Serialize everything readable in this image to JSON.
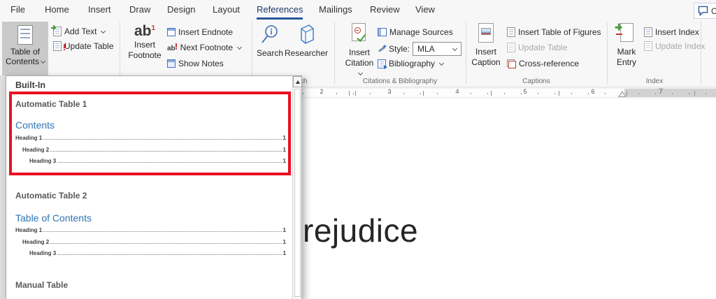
{
  "tabs": {
    "items": [
      "File",
      "Home",
      "Insert",
      "Draw",
      "Design",
      "Layout",
      "References",
      "Mailings",
      "Review",
      "View"
    ],
    "selected": "References"
  },
  "comments_button": {
    "visible_label": "C"
  },
  "ribbon": {
    "toc_button": {
      "line1": "Table of",
      "line2": "Contents"
    },
    "add_text_label": "Add Text",
    "update_table_label": "Update Table",
    "footnotes": {
      "insert_line1": "Insert",
      "insert_line2": "Footnote",
      "insert_endnote": "Insert Endnote",
      "next_footnote": "Next Footnote",
      "show_notes": "Show Notes"
    },
    "research": {
      "search": "Search",
      "researcher": "Researcher",
      "group_label": "Research"
    },
    "citations": {
      "insert_line1": "Insert",
      "insert_line2": "Citation",
      "manage_sources": "Manage Sources",
      "style_label": "Style:",
      "style_value": "MLA",
      "bibliography": "Bibliography",
      "group_label": "Citations & Bibliography"
    },
    "captions": {
      "insert_line1": "Insert",
      "insert_line2": "Caption",
      "insert_table_of_figures": "Insert Table of Figures",
      "update_table": "Update Table",
      "cross_reference": "Cross-reference",
      "group_label": "Captions"
    },
    "index": {
      "mark_line1": "Mark",
      "mark_line2": "Entry",
      "insert_index": "Insert Index",
      "update_index": "Update Index",
      "group_label": "Index"
    }
  },
  "icon_glyphs": {
    "footnote_ab": "ab",
    "footnote_sup": "1",
    "next_footnote_ab": "ab"
  },
  "ruler": {
    "numbers": [
      "2",
      "3",
      "4",
      "5",
      "6",
      "7"
    ]
  },
  "dropdown": {
    "built_in": "Built-In",
    "sections": [
      {
        "title": "Automatic Table 1",
        "toc_title": "Contents",
        "entries": [
          {
            "label": "Heading 1",
            "page": "1"
          },
          {
            "label": "Heading 2",
            "page": "1"
          },
          {
            "label": "Heading 3",
            "page": "1"
          }
        ]
      },
      {
        "title": "Automatic Table 2",
        "toc_title": "Table of Contents",
        "entries": [
          {
            "label": "Heading 1",
            "page": "1"
          },
          {
            "label": "Heading 2",
            "page": "1"
          },
          {
            "label": "Heading 3",
            "page": "1"
          }
        ]
      },
      {
        "title": "Manual Table"
      }
    ]
  },
  "document": {
    "visible_text": "rejudice"
  },
  "colors": {
    "accent_blue": "#2b579a",
    "highlight_red": "#e81123",
    "toc_heading_blue": "#2e74b5",
    "pressed_button_bg": "#c9c9c9",
    "disabled_text": "#a9a9a9"
  }
}
